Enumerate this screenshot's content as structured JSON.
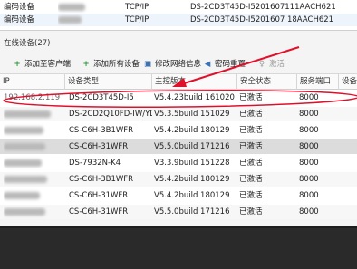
{
  "top_list": {
    "rows": [
      {
        "name": "编码设备",
        "protocol": "TCP/IP",
        "info": "DS-2CD3T45D-I5201607111AACH621"
      },
      {
        "name": "编码设备",
        "protocol": "TCP/IP",
        "info": "DS-2CD3T45D-I5201607 18AACH621"
      }
    ]
  },
  "section_title": "在线设备(27)",
  "toolbar": {
    "add_client": "添加至客户端",
    "add_all": "添加所有设备",
    "modify_network": "修改网络信息",
    "reset_password": "密码重置",
    "activate": "激活"
  },
  "table": {
    "columns": [
      "IP",
      "设备类型",
      "主控版本",
      "安全状态",
      "服务端口",
      "设备序"
    ],
    "rows": [
      {
        "ip": "192.168.2.119",
        "type": "DS-2CD3T45D-I5",
        "version": "V5.4.23build 161020",
        "state": "已激活",
        "port": "8000"
      },
      {
        "ip": "1    20",
        "type": "DS-2CD2Q10FD-IW/YD",
        "version": "V5.3.5build 151029",
        "state": "已激活",
        "port": "8000"
      },
      {
        "ip": "",
        "type": "CS-C6H-3B1WFR",
        "version": "V5.4.2build 180129",
        "state": "已激活",
        "port": "8000"
      },
      {
        "ip": "",
        "type": "CS-C6H-31WFR",
        "version": "V5.5.0build 171216",
        "state": "已激活",
        "port": "8000"
      },
      {
        "ip": "",
        "type": "DS-7932N-K4",
        "version": "V3.3.9build 151228",
        "state": "已激活",
        "port": "8000"
      },
      {
        "ip": "",
        "type": "CS-C6H-3B1WFR",
        "version": "V5.4.2build 180129",
        "state": "已激活",
        "port": "8000"
      },
      {
        "ip": "",
        "type": "CS-C6H-31WFR",
        "version": "V5.4.2build 180129",
        "state": "已激活",
        "port": "8000"
      },
      {
        "ip": "",
        "type": "CS-C6H-31WFR",
        "version": "V5.5.0build 171216",
        "state": "已激活",
        "port": "8000"
      }
    ]
  },
  "colors": {
    "annotation": "#e0102a",
    "add_icon": "#2e9a3a",
    "selected_row": "#dcdcdc"
  }
}
